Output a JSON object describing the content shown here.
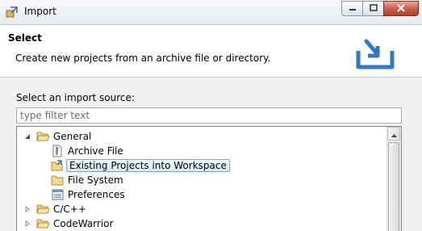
{
  "window": {
    "title": "Import",
    "app_icon": "eclipse-import-icon",
    "caption": {
      "minimize_icon": "minimize-icon",
      "maximize_icon": "maximize-icon",
      "close_icon": "close-icon"
    }
  },
  "header": {
    "title": "Select",
    "description": "Create new projects from an archive file or directory.",
    "graphic": "import-wizard-banner-icon"
  },
  "body": {
    "prompt": "Select an import source:",
    "filter_placeholder": "type filter text",
    "filter_value": ""
  },
  "tree": {
    "items": [
      {
        "label": "General",
        "level": 0,
        "expanded": true,
        "icon": "folder-open-icon"
      },
      {
        "label": "Archive File",
        "level": 1,
        "icon": "archive-file-icon"
      },
      {
        "label": "Existing Projects into Workspace",
        "level": 1,
        "icon": "existing-projects-icon",
        "selected": true
      },
      {
        "label": "File System",
        "level": 1,
        "icon": "folder-icon"
      },
      {
        "label": "Preferences",
        "level": 1,
        "icon": "preferences-icon"
      },
      {
        "label": "C/C++",
        "level": 0,
        "expanded": false,
        "icon": "folder-icon"
      },
      {
        "label": "CodeWarrior",
        "level": 0,
        "expanded": false,
        "icon": "folder-icon"
      }
    ]
  },
  "colors": {
    "selection_border": "#7da2ce",
    "selection_fill": "#d5e8fb",
    "folder": "#e8c46a",
    "close_button": "#c75b44"
  }
}
